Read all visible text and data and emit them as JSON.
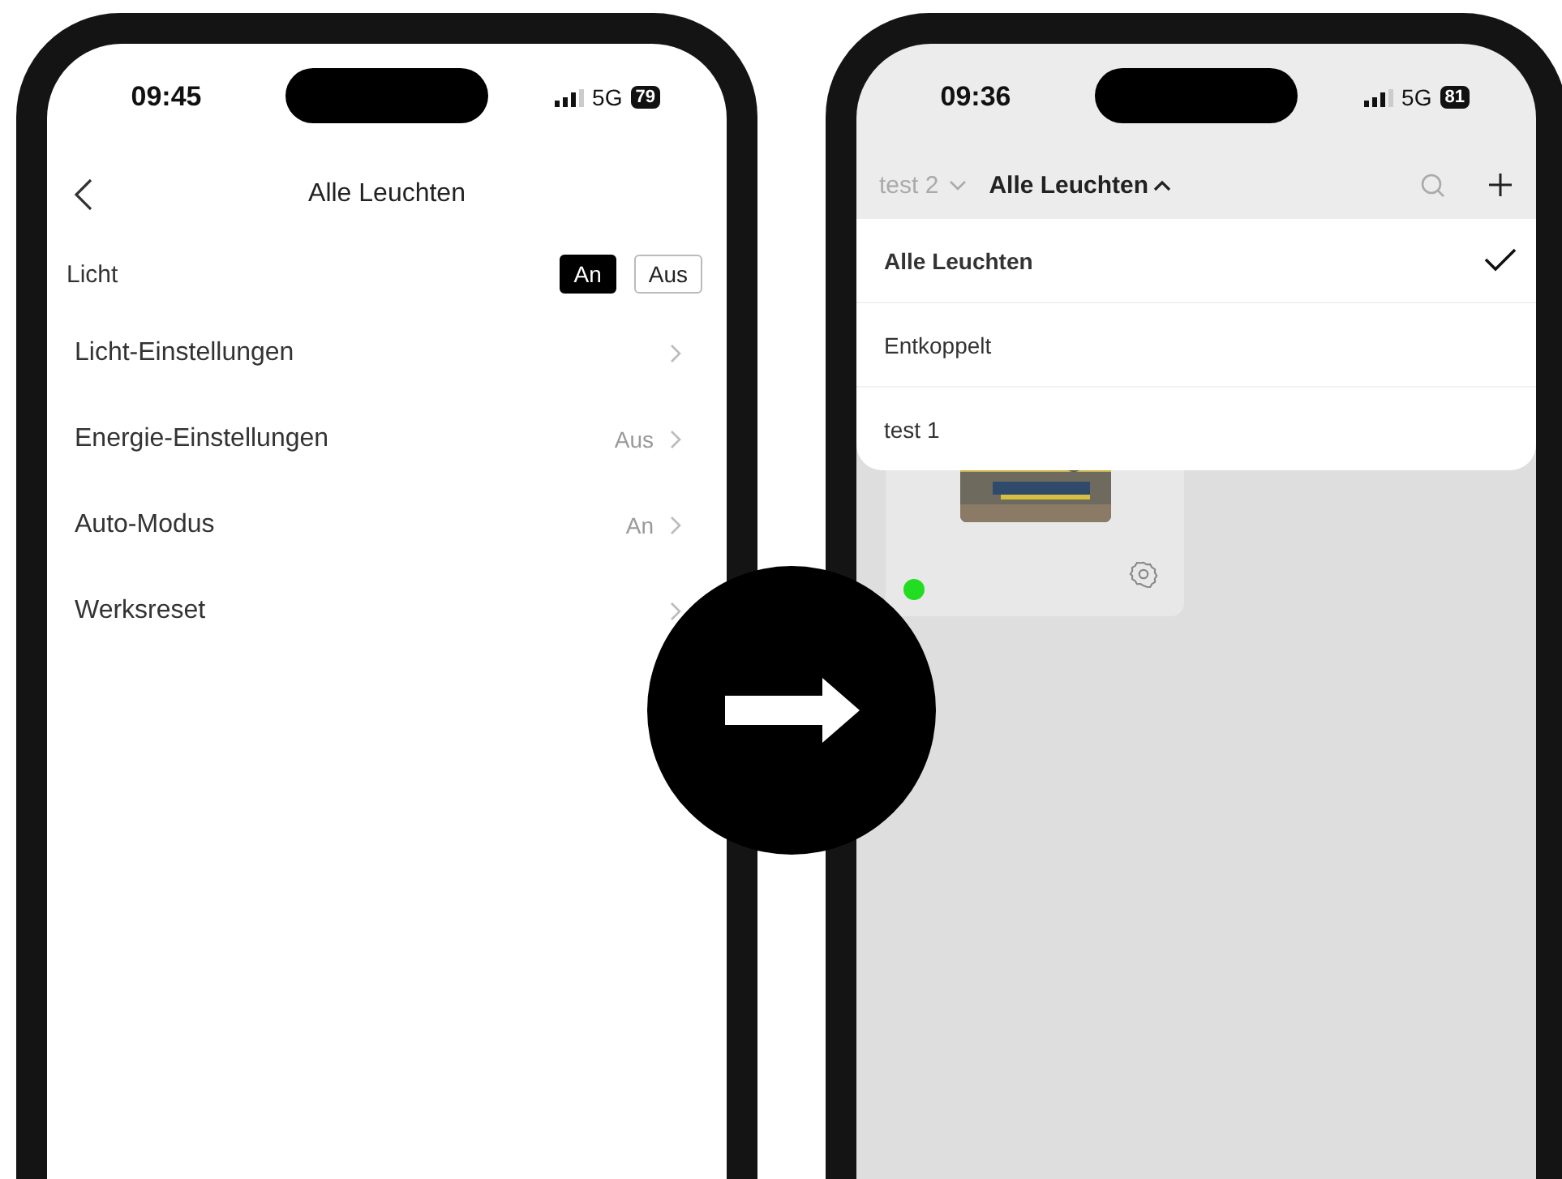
{
  "left_phone": {
    "status": {
      "time": "09:45",
      "network": "5G",
      "battery": "79"
    },
    "nav": {
      "title": "Alle Leuchten"
    },
    "light_toggle": {
      "label": "Licht",
      "options": [
        {
          "label": "An",
          "selected": true
        },
        {
          "label": "Aus",
          "selected": false
        }
      ]
    },
    "rows": [
      {
        "label": "Licht-Einstellungen"
      },
      {
        "label": "Energie-Einstellungen",
        "value": "Aus"
      },
      {
        "label": "Auto-Modus",
        "value": "An"
      },
      {
        "label": "Werksreset"
      }
    ]
  },
  "right_phone": {
    "status": {
      "time": "09:36",
      "network": "5G",
      "battery": "81"
    },
    "header": {
      "home": "test 2",
      "group": "Alle Leuchten"
    },
    "dropdown": [
      {
        "label": "Alle Leuchten",
        "selected": true
      },
      {
        "label": "Entkoppelt",
        "selected": false
      },
      {
        "label": "test 1",
        "selected": false
      }
    ],
    "device": {
      "kind": "picture",
      "online": true
    }
  }
}
